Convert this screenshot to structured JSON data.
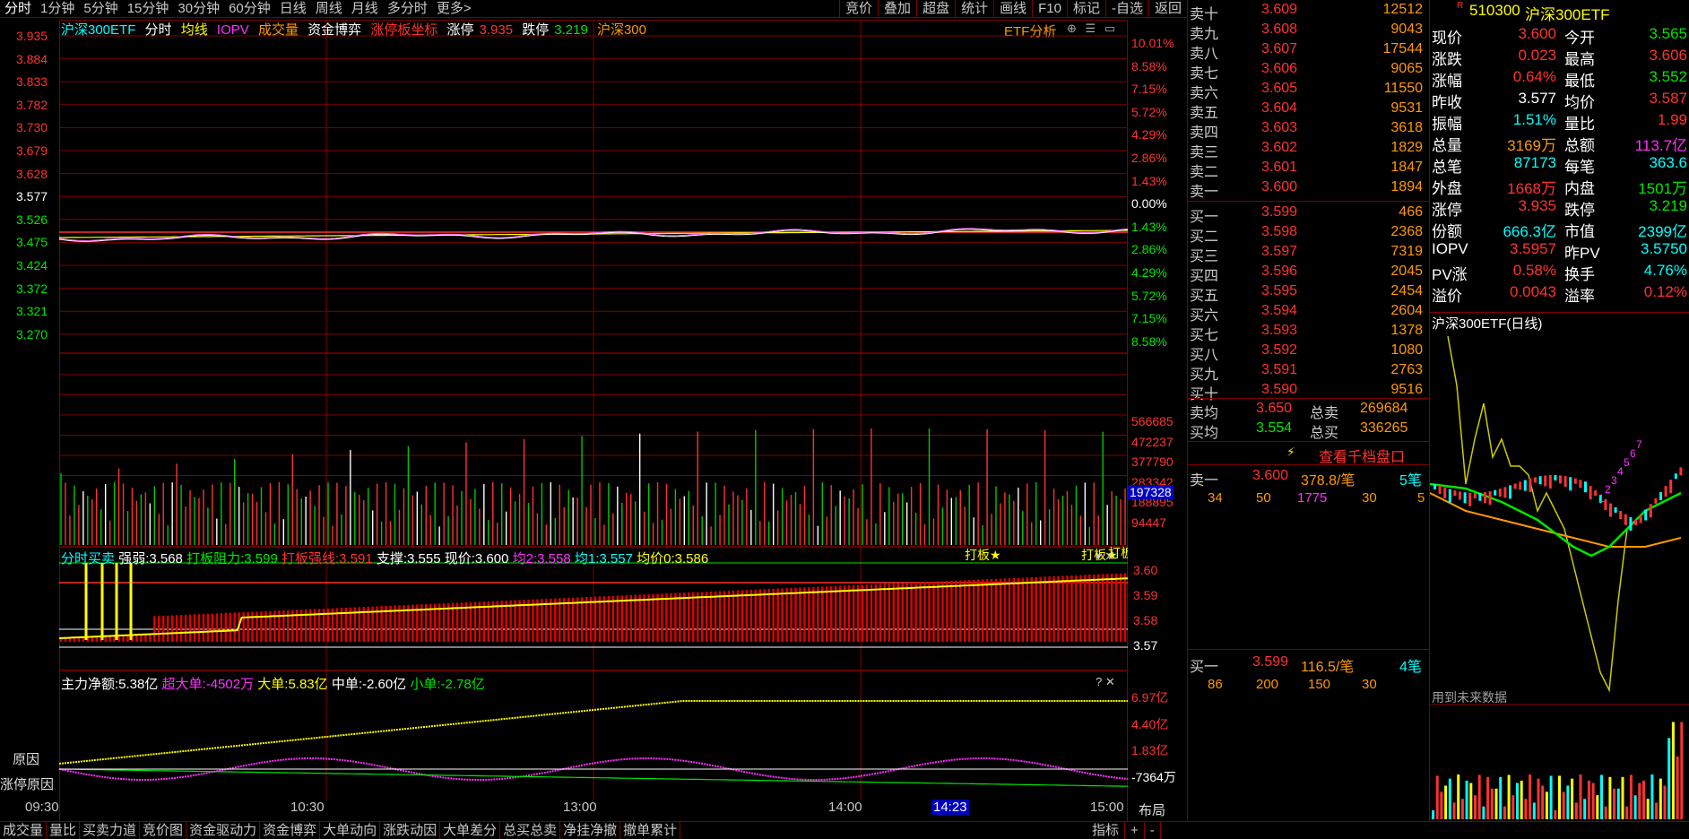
{
  "toolbar": {
    "tabs": [
      "分时",
      "1分钟",
      "5分钟",
      "15分钟",
      "30分钟",
      "60分钟",
      "日线",
      "周线",
      "月线",
      "多分时",
      "更多>"
    ],
    "right_buttons": [
      "竞价",
      "叠加",
      "超盘",
      "统计",
      "画线",
      "F10",
      "标记",
      "-自选",
      "返回"
    ]
  },
  "legend": {
    "name": "沪深300ETF",
    "items": [
      "分时",
      "均线",
      "IOPV",
      "成交量",
      "资金博弈",
      "涨停板坐标"
    ],
    "zt_label": "涨停",
    "zt_val": "3.935",
    "dt_label": "跌停",
    "dt_val": "3.219",
    "index": "沪深300",
    "etf_label": "ETF分析"
  },
  "price_axis": {
    "left": [
      "3.935",
      "3.884",
      "3.833",
      "3.782",
      "3.730",
      "3.679",
      "3.628",
      "3.577",
      "3.526",
      "3.475",
      "3.424",
      "3.372",
      "3.321",
      "3.270"
    ],
    "right": [
      "10.01%",
      "8.58%",
      "7.15%",
      "5.72%",
      "4.29%",
      "2.86%",
      "1.43%",
      "0.00%",
      "1.43%",
      "2.86%",
      "4.29%",
      "5.72%",
      "7.15%",
      "8.58%"
    ]
  },
  "volume_axis": [
    "566685",
    "472237",
    "377790",
    "283342",
    "188895",
    "94447"
  ],
  "volume_highlight": "197328",
  "buysell_panel": {
    "title": "分时买卖",
    "strong_label": "强弱:",
    "strong_val": "3.568",
    "resist_label": "打板阻力:",
    "resist_val": "3.599",
    "strong_line_label": "打板强线:",
    "strong_line_val": "3.591",
    "support_label": "支撑:",
    "support_val": "3.555",
    "price_label": "现价:",
    "price_val": "3.600",
    "avg2_label": "均2:",
    "avg2_val": "3.558",
    "avg1_label": "均1:",
    "avg1_val": "3.557",
    "avg0_label": "均价0:",
    "avg0_val": "3.586",
    "axis": [
      "3.60",
      "3.59",
      "3.58",
      "3.57"
    ],
    "marks": [
      "打板★",
      "打板★",
      "打板★"
    ]
  },
  "capital_panel": {
    "main_label": "主力净额:",
    "main_val": "5.38亿",
    "super_label": "超大单:",
    "super_val": "-4502万",
    "big_label": "大单:",
    "big_val": "5.83亿",
    "mid_label": "中单:",
    "mid_val": "-2.60亿",
    "small_label": "小单:",
    "small_val": "-2.78亿",
    "axis": [
      "6.97亿",
      "4.40亿",
      "1.83亿",
      "-7364万"
    ]
  },
  "left_buttons": [
    "原因",
    "涨停原因"
  ],
  "time_axis": [
    "09:30",
    "10:30",
    "13:00",
    "14:00",
    "15:00"
  ],
  "time_cursor": "14:23",
  "layout_label": "布局",
  "orderbook": {
    "asks": [
      {
        "label": "卖十",
        "price": "3.609",
        "vol": "12512"
      },
      {
        "label": "卖九",
        "price": "3.608",
        "vol": "9043"
      },
      {
        "label": "卖八",
        "price": "3.607",
        "vol": "17544"
      },
      {
        "label": "卖七",
        "price": "3.606",
        "vol": "9065"
      },
      {
        "label": "卖六",
        "price": "3.605",
        "vol": "11550"
      },
      {
        "label": "卖五",
        "price": "3.604",
        "vol": "9531"
      },
      {
        "label": "卖四",
        "price": "3.603",
        "vol": "3618"
      },
      {
        "label": "卖三",
        "price": "3.602",
        "vol": "1829"
      },
      {
        "label": "卖二",
        "price": "3.601",
        "vol": "1847"
      },
      {
        "label": "卖一",
        "price": "3.600",
        "vol": "1894"
      }
    ],
    "bids": [
      {
        "label": "买一",
        "price": "3.599",
        "vol": "466"
      },
      {
        "label": "买二",
        "price": "3.598",
        "vol": "2368"
      },
      {
        "label": "买三",
        "price": "3.597",
        "vol": "7319"
      },
      {
        "label": "买四",
        "price": "3.596",
        "vol": "2045"
      },
      {
        "label": "买五",
        "price": "3.595",
        "vol": "2454"
      },
      {
        "label": "买六",
        "price": "3.594",
        "vol": "2604"
      },
      {
        "label": "买七",
        "price": "3.593",
        "vol": "1378"
      },
      {
        "label": "买八",
        "price": "3.592",
        "vol": "1080"
      },
      {
        "label": "买九",
        "price": "3.591",
        "vol": "2763"
      },
      {
        "label": "买十",
        "price": "3.590",
        "vol": "9516"
      }
    ],
    "ask_avg_label": "卖均",
    "ask_avg": "3.650",
    "ask_total_label": "总卖",
    "ask_total": "269684",
    "bid_avg_label": "买均",
    "bid_avg": "3.554",
    "bid_total_label": "总买",
    "bid_total": "336265",
    "more_label": "查看千档盘口",
    "queue1": {
      "label": "卖一",
      "price": "3.600",
      "per": "378.8/笔",
      "count": "5笔",
      "items": [
        "34",
        "50",
        "1775",
        "30",
        "5"
      ]
    },
    "queue2": {
      "label": "买一",
      "price": "3.599",
      "per": "116.5/笔",
      "count": "4笔",
      "items": [
        "86",
        "200",
        "150",
        "30"
      ]
    }
  },
  "info": {
    "code": "510300",
    "name": "沪深300ETF",
    "rows": [
      {
        "l1": "现价",
        "v1": "3.600",
        "c1": "red",
        "l2": "今开",
        "v2": "3.565",
        "c2": "green"
      },
      {
        "l1": "涨跌",
        "v1": "0.023",
        "c1": "red",
        "l2": "最高",
        "v2": "3.606",
        "c2": "red"
      },
      {
        "l1": "涨幅",
        "v1": "0.64%",
        "c1": "red",
        "l2": "最低",
        "v2": "3.552",
        "c2": "green"
      },
      {
        "l1": "昨收",
        "v1": "3.577",
        "c1": "white",
        "l2": "均价",
        "v2": "3.587",
        "c2": "red"
      },
      {
        "l1": "振幅",
        "v1": "1.51%",
        "c1": "cyan",
        "l2": "量比",
        "v2": "1.99",
        "c2": "red"
      },
      {
        "l1": "总量",
        "v1": "3169万",
        "c1": "orange",
        "l2": "总额",
        "v2": "113.7亿",
        "c2": "magenta"
      },
      {
        "l1": "总笔",
        "v1": "87173",
        "c1": "cyan",
        "l2": "每笔",
        "v2": "363.6",
        "c2": "cyan"
      },
      {
        "l1": "外盘",
        "v1": "1668万",
        "c1": "red",
        "l2": "内盘",
        "v2": "1501万",
        "c2": "green"
      },
      {
        "l1": "涨停",
        "v1": "3.935",
        "c1": "red",
        "l2": "跌停",
        "v2": "3.219",
        "c2": "green"
      },
      {
        "l1": "份额",
        "v1": "666.3亿",
        "c1": "cyan",
        "l2": "市值",
        "v2": "2399亿",
        "c2": "cyan"
      },
      {
        "l1": "IOPV",
        "v1": "3.5957",
        "c1": "red",
        "l2": "昨PV",
        "v2": "3.5750",
        "c2": "cyan"
      },
      {
        "l1": "PV涨",
        "v1": "0.58%",
        "c1": "red",
        "l2": "换手",
        "v2": "4.76%",
        "c2": "cyan"
      },
      {
        "l1": "溢价",
        "v1": "0.0043",
        "c1": "red",
        "l2": "溢率",
        "v2": "0.12%",
        "c2": "red"
      }
    ],
    "mini_title": "沪深300ETF(日线)",
    "mini_note": "用到未来数据",
    "mini_nums": [
      "7",
      "6",
      "5",
      "4",
      "3",
      "2",
      "1"
    ]
  },
  "bottom_tabs": [
    "成交量",
    "量比",
    "买卖力道",
    "竞价图",
    "资金驱动力",
    "资金博弈",
    "大单动向",
    "涨跌动因",
    "大单差分",
    "总买总卖",
    "净挂净撤",
    "撤单累计"
  ],
  "bottom_right": [
    "指标",
    "+",
    "-"
  ]
}
